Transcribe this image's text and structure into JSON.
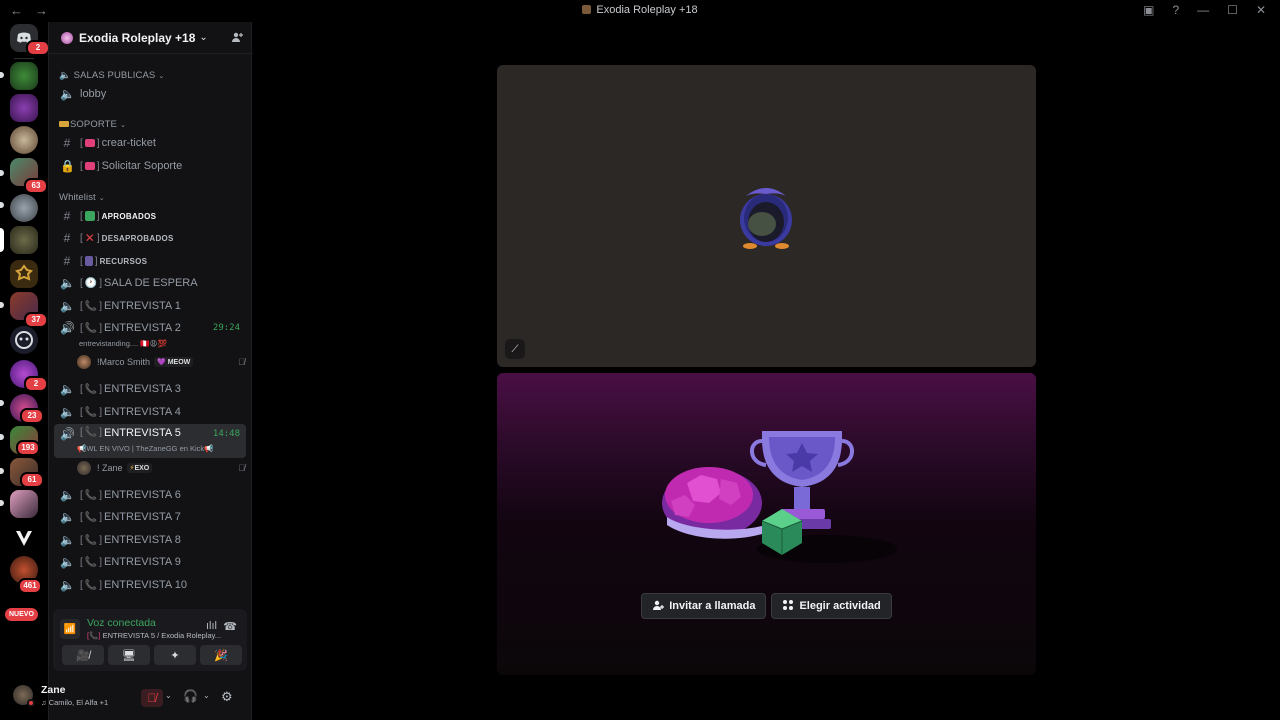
{
  "titlebar": {
    "title": "Exodia Roleplay +18",
    "back_icon": "←",
    "forward_icon": "→",
    "inbox_icon": "▣",
    "help_icon": "?",
    "minimize_icon": "—",
    "maximize_icon": "☐",
    "close_icon": "✕"
  },
  "rail": {
    "badges": {
      "dm": "2",
      "s5": "63",
      "s10": "37",
      "s13": "2",
      "s14": "23",
      "s15": "193",
      "s16": "61",
      "s20": "461"
    },
    "nuevo": "NUEVO"
  },
  "guild": {
    "name": "Exodia Roleplay +18"
  },
  "categories": {
    "salas": "SALAS PUBLICAS",
    "soporte": "SOPORTE",
    "whitelist": "Whitelist"
  },
  "channels": {
    "lobby": "lobby",
    "crear_ticket": "crear-ticket",
    "solicitar_soporte": "Solicitar Soporte",
    "aprobados": "APROBADOS",
    "desaprobados": "DESAPROBADOS",
    "recursos": "RECURSOS",
    "sala_espera": "SALA DE ESPERA",
    "ent1": "ENTREVISTA 1",
    "ent2": "ENTREVISTA 2",
    "ent2_timer": "29:24",
    "ent2_status": "entrevistanding....",
    "ent2_user": "!Marco Smith",
    "ent2_user_tag": "MEOW",
    "ent3": "ENTREVISTA 3",
    "ent4": "ENTREVISTA 4",
    "ent5": "ENTREVISTA 5",
    "ent5_timer": "14:48",
    "ent5_status": "WL EN VIVO | TheZaneGG en Kick",
    "ent5_user": "! Zane",
    "ent5_user_tag": "EXO",
    "ent6": "ENTREVISTA 6",
    "ent7": "ENTREVISTA 7",
    "ent8": "ENTREVISTA 8",
    "ent9": "ENTREVISTA 9",
    "ent10": "ENTREVISTA 10"
  },
  "voice": {
    "status": "Voz conectada",
    "channel": "ENTREVISTA 5 / Exodia Roleplay..."
  },
  "user": {
    "name": "Zane",
    "activity": "Camilo, El Alfa +1"
  },
  "actions": {
    "invite": "Invitar a llamada",
    "activity": "Elegir actividad"
  },
  "colors": {
    "accent_green": "#3ba55d",
    "danger_red": "#e33f44",
    "sidebar_bg": "#121214"
  }
}
